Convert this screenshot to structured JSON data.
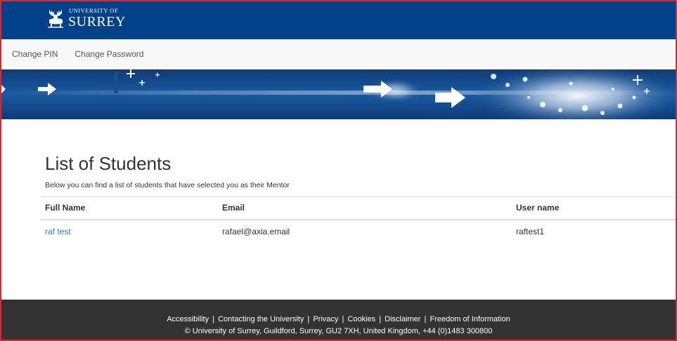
{
  "header": {
    "logo_small": "UNIVERSITY OF",
    "logo_big": "SURREY"
  },
  "nav": {
    "items": [
      {
        "label": "Change PIN"
      },
      {
        "label": "Change Password"
      }
    ]
  },
  "main": {
    "title": "List of Students",
    "intro": "Below you can find a list of students that have selected you as their Mentor",
    "table": {
      "headers": [
        "Full Name",
        "Email",
        "User name"
      ],
      "rows": [
        {
          "name": "raf test",
          "email": "rafael@axia.email",
          "username": "raftest1"
        }
      ]
    }
  },
  "footer": {
    "links": [
      {
        "label": "Accessibility"
      },
      {
        "label": "Contacting the University"
      },
      {
        "label": "Privacy"
      },
      {
        "label": "Cookies"
      },
      {
        "label": "Disclaimer"
      },
      {
        "label": "Freedom of Information"
      }
    ],
    "separator": "|",
    "copyright": "© University of Surrey, Guildford, Surrey, GU2 7XH, United Kingdom, +44 (0)1483 300800"
  },
  "colors": {
    "header_bg": "#004289",
    "accent_link": "#337ab7",
    "footer_bg": "#333333",
    "frame_border": "#e0262c"
  },
  "icons": {
    "logo": "stag-icon",
    "banner_arrows": "arrow-right-icon",
    "banner_plus": "plus-icon"
  }
}
